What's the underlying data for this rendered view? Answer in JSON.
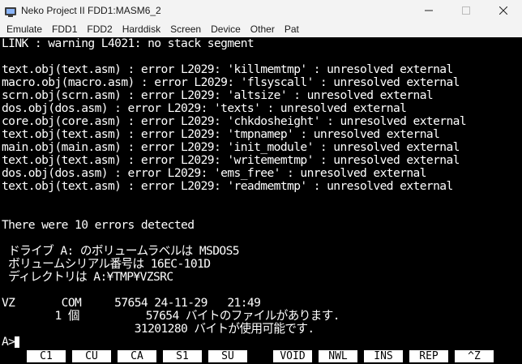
{
  "window": {
    "title": "Neko Project II  FDD1:MASM6_2"
  },
  "menu": [
    "Emulate",
    "FDD1",
    "FDD2",
    "Harddisk",
    "Screen",
    "Device",
    "Other",
    "Pat"
  ],
  "terminal": {
    "lines": [
      "LINK : warning L4021: no stack segment",
      "",
      "text.obj(text.asm) : error L2029: 'killmemtmp' : unresolved external",
      "macro.obj(macro.asm) : error L2029: 'flsyscall' : unresolved external",
      "scrn.obj(scrn.asm) : error L2029: 'altsize' : unresolved external",
      "dos.obj(dos.asm) : error L2029: 'texts' : unresolved external",
      "core.obj(core.asm) : error L2029: 'chkdosheight' : unresolved external",
      "text.obj(text.asm) : error L2029: 'tmpnamep' : unresolved external",
      "main.obj(main.asm) : error L2029: 'init_module' : unresolved external",
      "text.obj(text.asm) : error L2029: 'writememtmp' : unresolved external",
      "dos.obj(dos.asm) : error L2029: 'ems_free' : unresolved external",
      "text.obj(text.asm) : error L2029: 'readmemtmp' : unresolved external",
      "",
      "",
      "There were 10 errors detected",
      "",
      " ドライブ A: のボリュームラベルは MSDOS5",
      " ボリュームシリアル番号は 16EC-101D",
      " ディレクトリは A:¥TMP¥VZSRC",
      "",
      "VZ       COM     57654 24-11-29   21:49",
      "        1 個          57654 バイトのファイルがあります.",
      "                    31201280 バイトが使用可能です.",
      "",
      "A>"
    ]
  },
  "function_keys": [
    "C1",
    "CU",
    "CA",
    "S1",
    "SU",
    "VOID",
    "NWL",
    "INS",
    "REP",
    "^Z"
  ]
}
